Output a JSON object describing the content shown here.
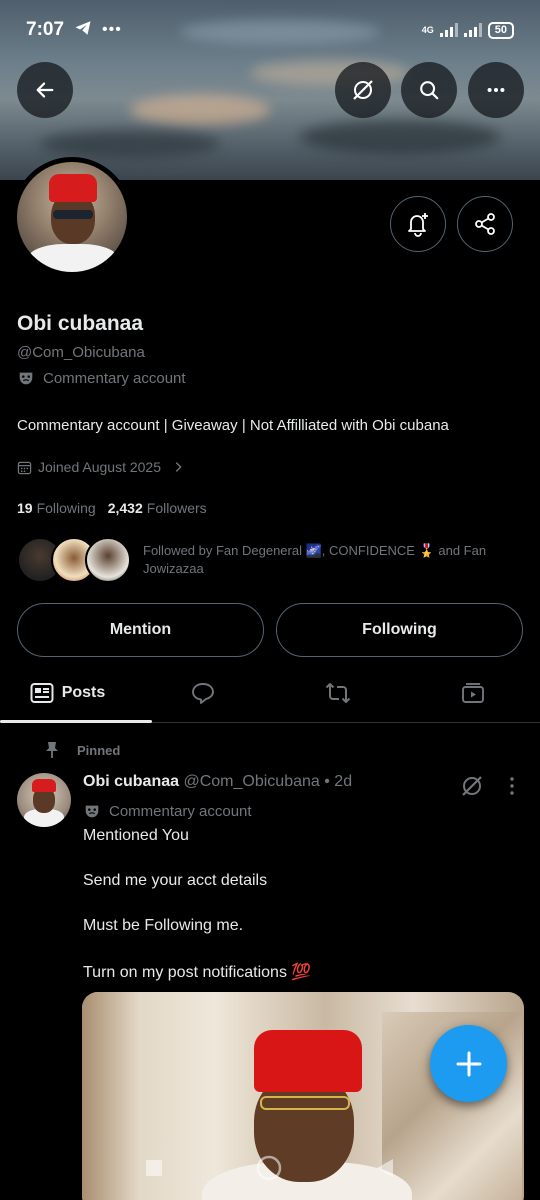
{
  "status": {
    "time": "7:07",
    "network": "4G",
    "battery": "50"
  },
  "profile": {
    "name": "Obi cubanaa",
    "handle": "@Com_Obicubana",
    "label": "Commentary account",
    "bio": "Commentary account | Giveaway | Not Affilliated with Obi cubana",
    "joined": "Joined August 2025",
    "following_count": "19",
    "following_label": "Following",
    "followers_count": "2,432",
    "followers_label": "Followers",
    "followed_by": "Followed by Fan Degeneral 🌌, CONFIDENCE 🎖️ and Fan Jowizazaa"
  },
  "buttons": {
    "mention": "Mention",
    "following": "Following"
  },
  "tabs": [
    {
      "label": "Posts",
      "icon": "posts-icon"
    },
    {
      "label": "",
      "icon": "reply-icon"
    },
    {
      "label": "",
      "icon": "repost-icon"
    },
    {
      "label": "",
      "icon": "media-icon"
    }
  ],
  "post": {
    "pinned": "Pinned",
    "author": "Obi cubanaa",
    "handle_time": "@Com_Obicubana • 2d",
    "label": "Commentary account",
    "lines": [
      "Mentioned You",
      "Send me your acct details",
      "Must be Following me.",
      "Turn on my post notifications 💯"
    ]
  },
  "colors": {
    "accent": "#1d9bf0",
    "background": "#000000",
    "muted": "#71767b",
    "text": "#e7e9ea",
    "border": "#536471"
  }
}
